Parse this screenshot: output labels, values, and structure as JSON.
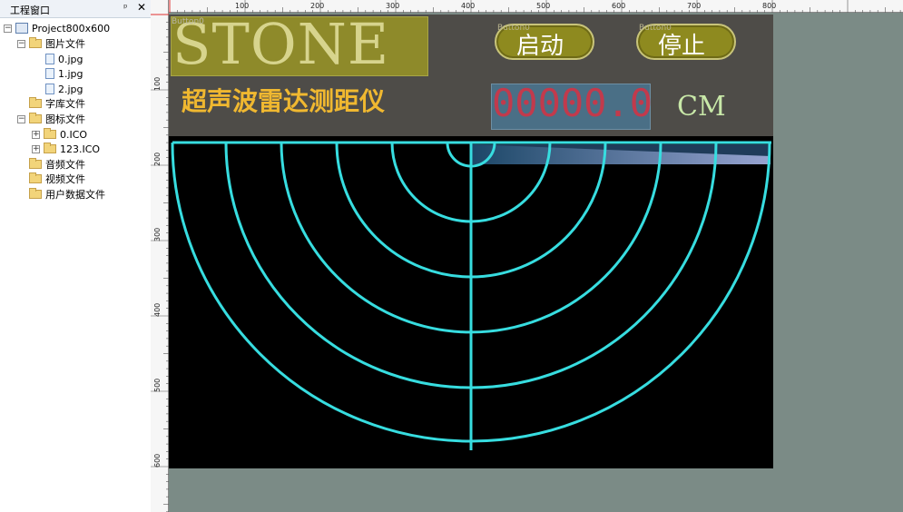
{
  "panel": {
    "title": "工程窗口",
    "pin_glyph": "ᵖ",
    "close_glyph": "✕",
    "tree": [
      {
        "id": "project",
        "label": "Project800x600",
        "toggle": "−",
        "icon": "project"
      },
      {
        "id": "images",
        "label": "图片文件",
        "toggle": "−",
        "icon": "folder"
      },
      {
        "id": "img0",
        "label": "0.jpg",
        "toggle": "",
        "icon": "file"
      },
      {
        "id": "img1",
        "label": "1.jpg",
        "toggle": "",
        "icon": "file"
      },
      {
        "id": "img2",
        "label": "2.jpg",
        "toggle": "",
        "icon": "file"
      },
      {
        "id": "fonts",
        "label": "字库文件",
        "toggle": "",
        "icon": "folder"
      },
      {
        "id": "icons",
        "label": "图标文件",
        "toggle": "−",
        "icon": "folder"
      },
      {
        "id": "ico0",
        "label": "0.ICO",
        "toggle": "+",
        "icon": "folder"
      },
      {
        "id": "ico123",
        "label": "123.ICO",
        "toggle": "+",
        "icon": "folder"
      },
      {
        "id": "audio",
        "label": "音频文件",
        "toggle": "",
        "icon": "folder"
      },
      {
        "id": "video",
        "label": "视频文件",
        "toggle": "",
        "icon": "folder"
      },
      {
        "id": "userdata",
        "label": "用户数据文件",
        "toggle": "",
        "icon": "folder"
      }
    ]
  },
  "ruler": {
    "top_labels": [
      "100",
      "200",
      "300",
      "400",
      "500",
      "600",
      "700",
      "800"
    ],
    "left_labels": [
      "100",
      "200",
      "300",
      "400",
      "500",
      "600"
    ]
  },
  "screen": {
    "logo": "STONE",
    "button_ghost_label": "Button0",
    "start_button": {
      "label": "启动",
      "ghost": "Button0"
    },
    "stop_button": {
      "label": "停止",
      "ghost": "Button0"
    },
    "title": "超声波雷达测距仪",
    "distance_value": "00000.0",
    "unit": "CM"
  },
  "colors": {
    "radar_line": "#37dde0",
    "radar_bg": "#000000",
    "canvas_bg": "#4e4c48",
    "workspace_bg": "#7b8b86"
  }
}
